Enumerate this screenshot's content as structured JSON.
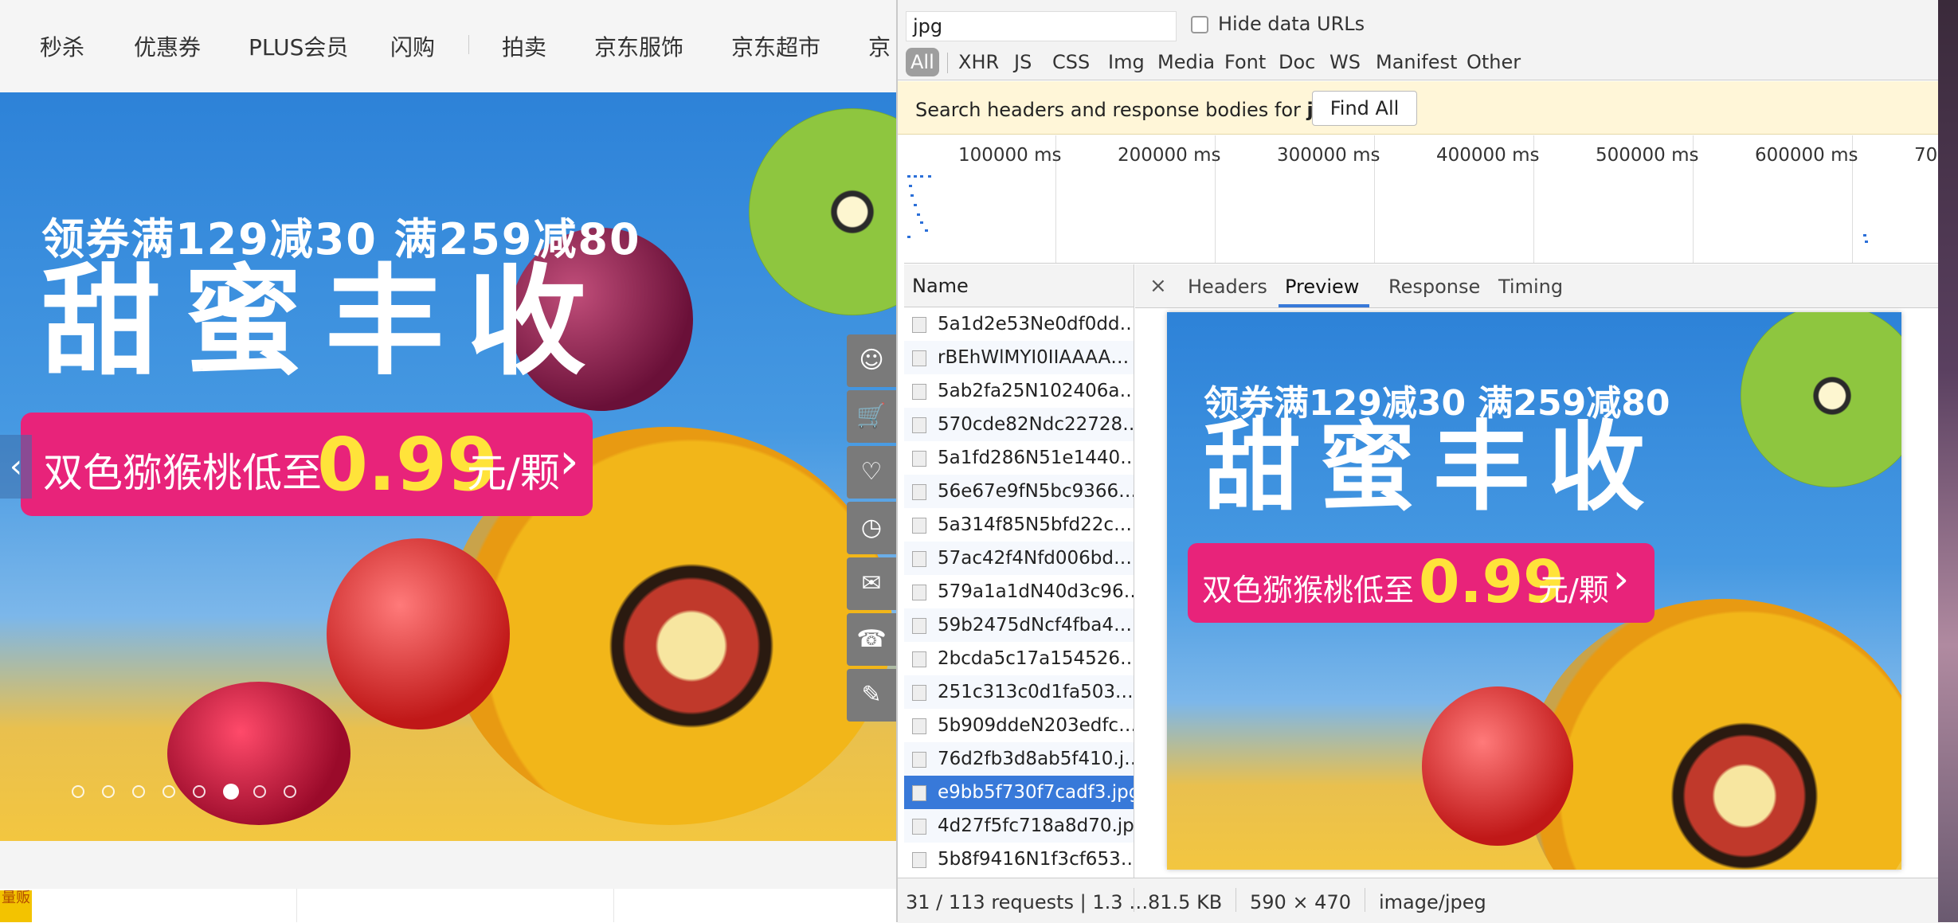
{
  "site": {
    "nav": [
      "秒杀",
      "优惠券",
      "PLUS会员",
      "闪购",
      "拍卖",
      "京东服饰",
      "京东超市",
      "京"
    ],
    "banner": {
      "headline": "领券满129减30 满259减80",
      "title": "甜蜜丰收",
      "promo_text": "双色猕猴桃低至",
      "promo_price": "0.99",
      "promo_unit": "元/颗",
      "promo_arrow": "›",
      "dots_count": 8,
      "active_dot": 6
    },
    "prev_arrow": "‹",
    "sidebar_icons": [
      "user-icon",
      "cart-icon",
      "heart-icon",
      "history-icon",
      "message-icon",
      "service-icon",
      "feedback-icon"
    ],
    "badge_text": "量贩"
  },
  "devtools": {
    "filter_value": "jpg",
    "hide_data_urls_label": "Hide data URLs",
    "hide_data_urls_checked": false,
    "types": [
      "All",
      "XHR",
      "JS",
      "CSS",
      "Img",
      "Media",
      "Font",
      "Doc",
      "WS",
      "Manifest",
      "Other"
    ],
    "active_type": "All",
    "search_prefix": "Search headers and response bodies for ",
    "search_term": "jpg",
    "find_all_label": "Find All",
    "timeline_labels": [
      "100000 ms",
      "200000 ms",
      "300000 ms",
      "400000 ms",
      "500000 ms",
      "600000 ms",
      "70"
    ],
    "name_header": "Name",
    "requests": [
      "5a1d2e53Ne0df0dd…",
      "rBEhWlMYI0IIAAAA…",
      "5ab2fa25N102406a…",
      "570cde82Ndc22728…",
      "5a1fd286N51e1440…",
      "56e67e9fN5bc9366…",
      "5a314f85N5bfd22c…",
      "57ac42f4Nfd006bd…",
      "579a1a1dN40d3c96…",
      "59b2475dNcf4fba4…",
      "2bcda5c17a154526…",
      "251c313c0d1fa503.…",
      "5b909ddeN203edfc…",
      "76d2fb3d8ab5f410.j…",
      "e9bb5f730f7cadf3.jpg",
      "4d27f5fc718a8d70.jpg",
      "5b8f9416N1f3cf653…"
    ],
    "selected_request": "e9bb5f730f7cadf3.jpg",
    "close_icon": "×",
    "tabs": [
      "Headers",
      "Preview",
      "Response",
      "Timing"
    ],
    "active_tab": "Preview",
    "status": {
      "requests": "31 / 113 requests | 1.3 …",
      "size": "81.5 KB",
      "dimensions": "590 × 470",
      "mime": "image/jpeg"
    }
  },
  "colors": {
    "promo_pink": "#e8237a",
    "price_yellow": "#ffe33a",
    "selection_blue": "#3879d9",
    "search_bar_yellow": "#fff6d8"
  }
}
